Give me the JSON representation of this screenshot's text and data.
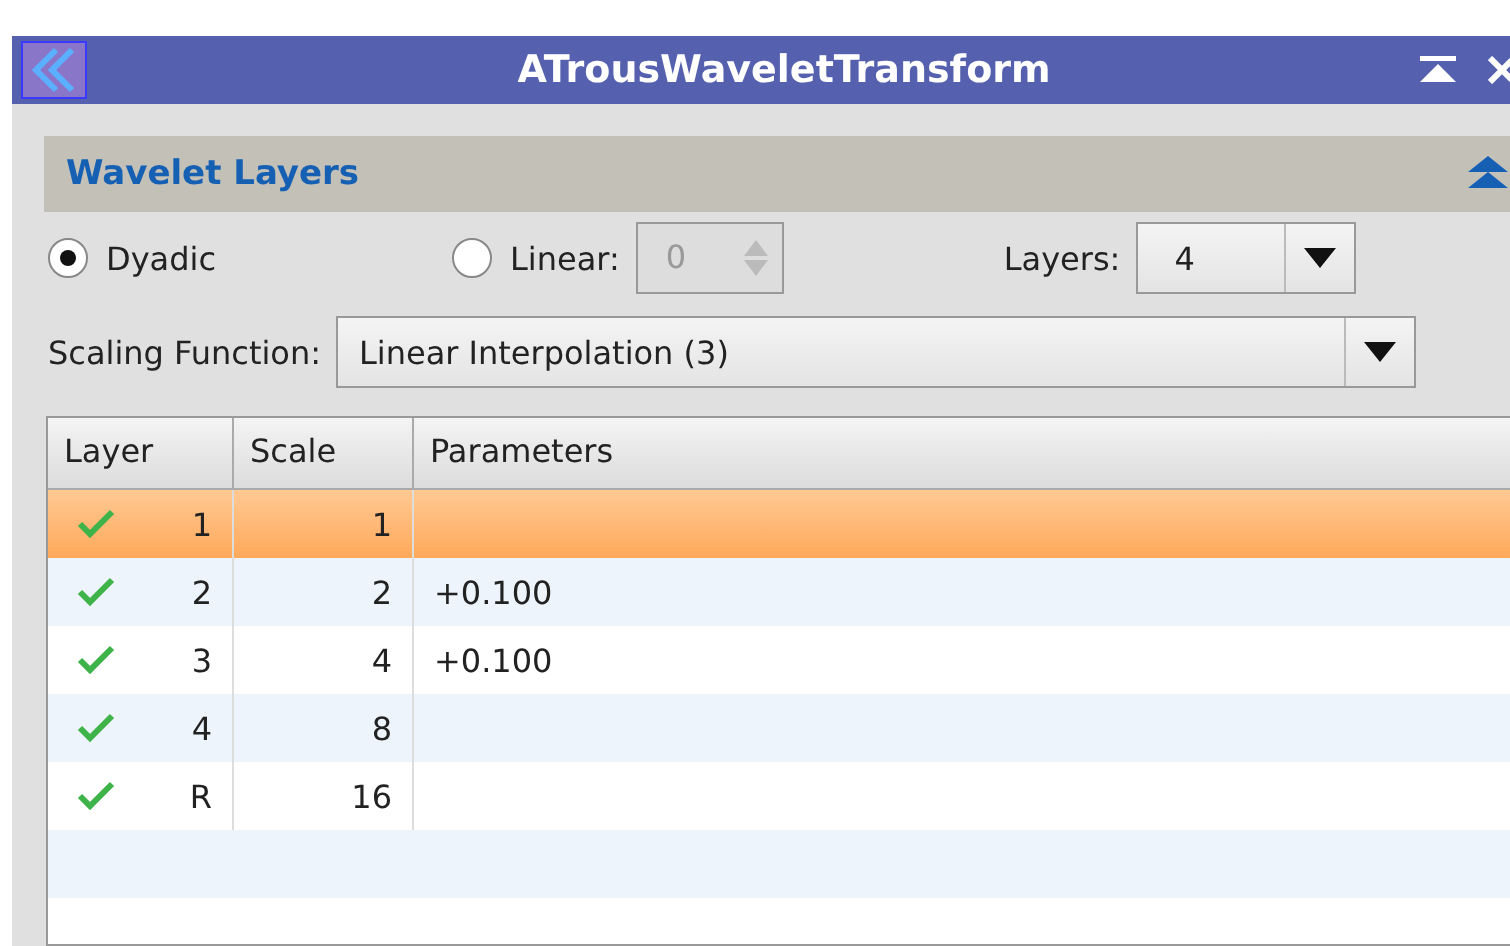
{
  "window": {
    "title": "ATrousWaveletTransform"
  },
  "section": {
    "title": "Wavelet Layers",
    "expanded": true
  },
  "layering": {
    "options": [
      {
        "label": "Dyadic",
        "selected": true
      },
      {
        "label": "Linear:",
        "selected": false
      }
    ],
    "linear_value": "0",
    "linear_disabled": true,
    "layers_label": "Layers:",
    "layers_value": "4"
  },
  "scaling": {
    "label": "Scaling Function:",
    "value": "Linear Interpolation (3)"
  },
  "table": {
    "columns": [
      "Layer",
      "Scale",
      "Parameters"
    ],
    "rows": [
      {
        "layer": "1",
        "scale": "1",
        "parameters": "",
        "checked": true,
        "selected": true
      },
      {
        "layer": "2",
        "scale": "2",
        "parameters": "+0.100",
        "checked": true,
        "selected": false
      },
      {
        "layer": "3",
        "scale": "4",
        "parameters": "+0.100",
        "checked": true,
        "selected": false
      },
      {
        "layer": "4",
        "scale": "8",
        "parameters": "",
        "checked": true,
        "selected": false
      },
      {
        "layer": "R",
        "scale": "16",
        "parameters": "",
        "checked": true,
        "selected": false
      }
    ]
  }
}
